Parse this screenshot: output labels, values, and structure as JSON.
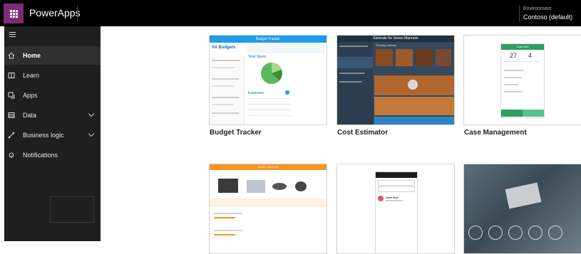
{
  "topbar": {
    "app_title": "PowerApps",
    "environment_label": "Environment",
    "environment_value": "Contoso (default)"
  },
  "sidebar": {
    "items": [
      {
        "label": "Home",
        "icon": "home-icon",
        "active": true
      },
      {
        "label": "Learn",
        "icon": "book-icon"
      },
      {
        "label": "Apps",
        "icon": "apps-icon"
      },
      {
        "label": "Data",
        "icon": "table-icon",
        "expandable": true
      },
      {
        "label": "Business logic",
        "icon": "flow-icon",
        "expandable": true
      },
      {
        "label": "Notifications",
        "icon": "bell-icon"
      }
    ]
  },
  "templates": [
    {
      "name": "Budget Tracker"
    },
    {
      "name": "Cost Estimator"
    },
    {
      "name": "Case Management"
    },
    {
      "name": ""
    },
    {
      "name": ""
    },
    {
      "name": ""
    }
  ],
  "thumb_text": {
    "budget_header": "Budget Tracker",
    "all_budgets": "All Budgets",
    "total_spent": "Total Spent",
    "expenses": "Expenses",
    "cost_header": "Estimate for Seven Marmots",
    "flooring_label": "Flooring choices",
    "case_header": "Case Info",
    "case_num_a": "27",
    "case_num_b": "4",
    "asset_header": "Asset Checkout",
    "contact_name": "Jane Doe"
  },
  "colors": {
    "brand": "#742774",
    "budget_blue": "#1d9ce8",
    "cost_navy": "#2c3e50",
    "case_green": "#2e9e63",
    "asset_orange": "#f7941d"
  }
}
